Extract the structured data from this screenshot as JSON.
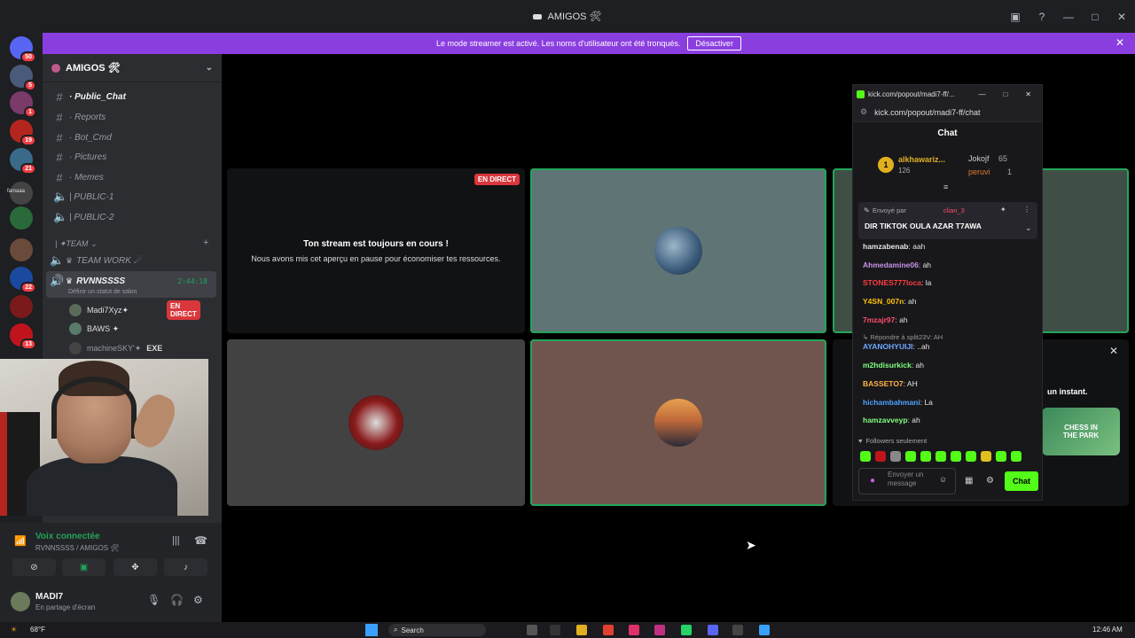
{
  "window": {
    "title": "AMIGOS 🛠"
  },
  "notice": {
    "text": "Le mode streamer est activé. Les noms d'utilisateur ont été tronqués.",
    "button": "Désactiver"
  },
  "rail": {
    "servers": [
      {
        "badge": "50",
        "color": "#5865f2"
      },
      {
        "badge": "5",
        "color": "#4a5a7a"
      },
      {
        "badge": "1",
        "color": "#7a3a6a"
      },
      {
        "badge": "19",
        "color": "#b3261e"
      },
      {
        "badge": "21",
        "color": "#3a6a8a"
      },
      {
        "badge": "",
        "color": "#444"
      },
      {
        "badge": "",
        "color": "#2a6a3a"
      },
      {
        "badge": "",
        "color": "#6a4a3a"
      },
      {
        "badge": "22",
        "color": "#1a4aa0"
      },
      {
        "badge": "",
        "color": "#7a1a1a"
      },
      {
        "badge": "13",
        "color": "#c0141c"
      }
    ],
    "wordmark": "famaaa"
  },
  "sidebar": {
    "server_name": "AMIGOS 🛠",
    "channels": [
      {
        "label": "· Public_Chat",
        "type": "text",
        "active": true
      },
      {
        "label": "· Reports",
        "type": "text"
      },
      {
        "label": "· Bot_Cmd",
        "type": "text"
      },
      {
        "label": "· Pictures",
        "type": "text"
      },
      {
        "label": "· Memes",
        "type": "text"
      },
      {
        "label": "| PUBLIC-1",
        "type": "voice"
      },
      {
        "label": "| PUBLIC-2",
        "type": "voice"
      }
    ],
    "category": "| ✦TEAM ⌄",
    "voice_channels": [
      {
        "label": "TEAM WORK ☄",
        "active": false
      },
      {
        "label": "RVNNSSSS",
        "active": true,
        "timer": "2:44:18",
        "status": "Définir un statut de salon"
      }
    ],
    "voice_users": [
      {
        "name": "Madi7Xyz✦",
        "live": "EN DIRECT"
      },
      {
        "name": "BAWS ✦",
        "live": ""
      },
      {
        "name": "machineSKY'✦",
        "live": "",
        "tag": "EXE"
      }
    ]
  },
  "user_panel": {
    "voice_title": "Voix connectée",
    "voice_sub": "RVNNSSSS / AMIGOS 🛠",
    "name": "MADI7",
    "status": "En partage d'écran"
  },
  "stage": {
    "live_badge": "EN DIRECT",
    "paused_title": "Ton stream est toujours en cours !",
    "paused_sub": "Nous avons mis cet aperçu en pause pour économiser tes ressources."
  },
  "kick": {
    "tab_title": "kick.com/popout/madi7-ff/...",
    "url": "kick.com/popout/madi7-ff/chat",
    "chat_title": "Chat",
    "leaderboard": [
      {
        "rank": "1",
        "name": "alkhawariz...",
        "count": "126"
      },
      {
        "rank": "",
        "name": "Jokojf",
        "count": "65"
      },
      {
        "rank": "",
        "name": "peruvi",
        "count": "1"
      }
    ],
    "pinned_by": "Envoyé par",
    "pinned_user": "clian_3",
    "pinned_text": "DIR TIKTOK OULA AZAR T7AWA",
    "messages": [
      {
        "user": "hamzabenab",
        "text": ": aah",
        "color": "#e5e5e5"
      },
      {
        "user": "Ahmedamine06",
        "text": ": ah",
        "color": "#c792ea"
      },
      {
        "user": "STONES777loca",
        "text": ": la",
        "color": "#ff3d3d"
      },
      {
        "user": "Y4SN_007n",
        "text": ": ah",
        "color": "#ffc107"
      },
      {
        "user": "7mzajr97",
        "text": ": ah",
        "color": "#ff4d6d"
      },
      {
        "user": "AYANOHYUIJI",
        "text": ": ..ah",
        "color": "#6ea8ff"
      },
      {
        "user": "m2hdisurkick",
        "text": ": ah",
        "color": "#7dff7d"
      },
      {
        "user": "BASSETO7",
        "text": ": AH",
        "color": "#ffb347"
      },
      {
        "user": "hichambahmani",
        "text": ": La",
        "color": "#4fa3ff"
      },
      {
        "user": "hamzavveyp",
        "text": ": ah",
        "color": "#7dff7d"
      }
    ],
    "reply_note": "↳ Répondre à split23V: AH",
    "followers_only": "Followers seulement",
    "input_placeholder": "Envoyer un message",
    "send_label": "Chat"
  },
  "side_panel": {
    "text": "un instant.",
    "promo": "CHESS IN THE PARK"
  },
  "taskbar": {
    "weather": "68°F",
    "search": "Search",
    "time": "12:46 AM"
  }
}
